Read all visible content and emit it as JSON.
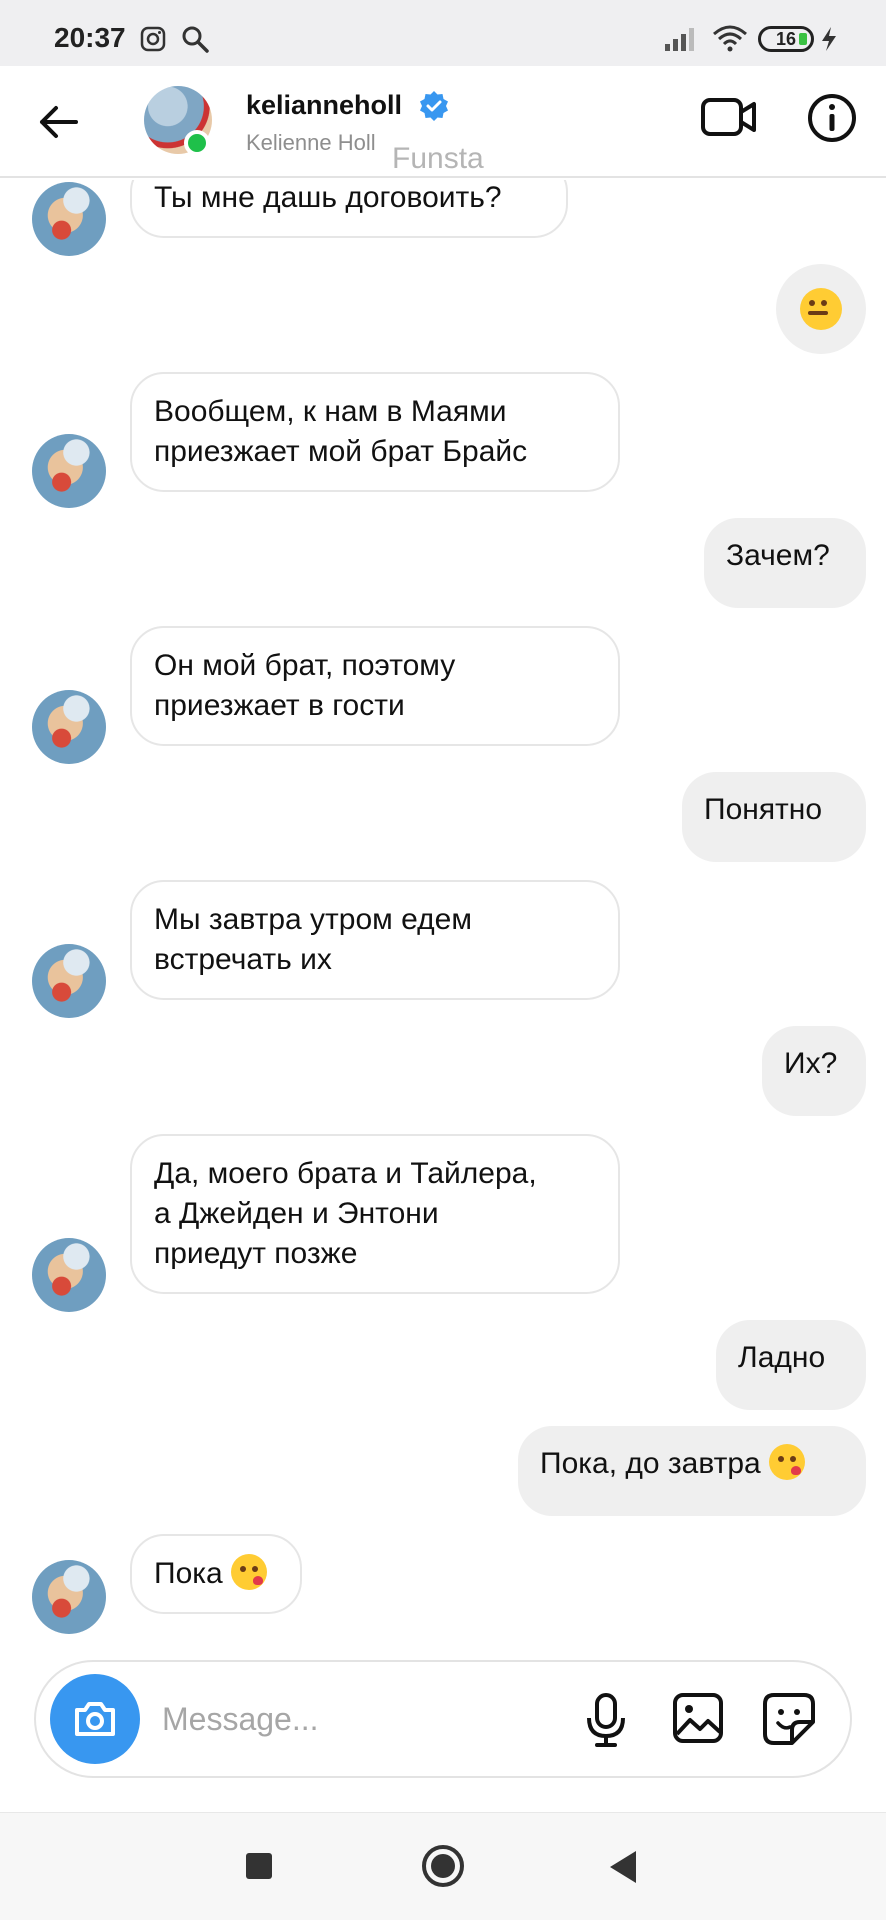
{
  "status_bar": {
    "time": "20:37",
    "battery": "16"
  },
  "header": {
    "username": "kelianneholl",
    "full_name": "Kelienne Holl",
    "watermark": "Funsta"
  },
  "messages": [
    {
      "side": "in",
      "text": "Ты мне дашь договоить?"
    },
    {
      "side": "out",
      "emoji": "zipper-mouth"
    },
    {
      "side": "in",
      "line1": "Вообщем, к нам  в Маями",
      "line2": "приезжает мой брат Брайс"
    },
    {
      "side": "out",
      "text": "Зачем?"
    },
    {
      "side": "in",
      "line1": "Он мой брат, поэтому",
      "line2": "приезжает в гости"
    },
    {
      "side": "out",
      "text": "Понятно"
    },
    {
      "side": "in",
      "line1": "Мы завтра утром едем",
      "line2": "встречать их"
    },
    {
      "side": "out",
      "text": "Их?"
    },
    {
      "side": "in",
      "line1": "Да, моего брата и Тайлера,",
      "line2": "а Джейден и Энтони",
      "line3": "приедут позже"
    },
    {
      "side": "out",
      "text": "Ладно"
    },
    {
      "side": "out",
      "text": "Пока, до завтра",
      "emoji": "kiss"
    },
    {
      "side": "in",
      "text": "Пока",
      "emoji": "kiss"
    }
  ],
  "composer": {
    "placeholder": "Message..."
  },
  "colors": {
    "accent": "#3897f0",
    "verified": "#3897f0",
    "online": "#1fc04a",
    "outgoing_bubble": "#efefef"
  }
}
